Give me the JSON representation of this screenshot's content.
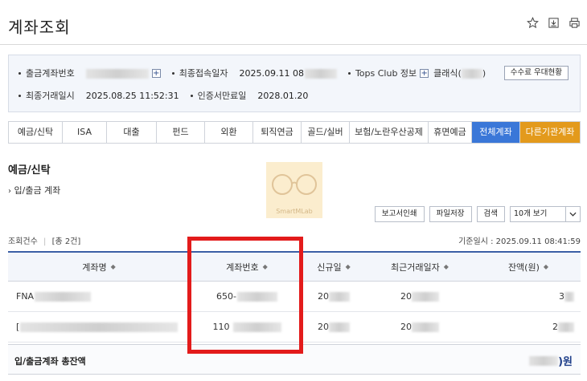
{
  "page": {
    "title": "계좌조회"
  },
  "toolbar": {
    "icons": [
      "star-icon",
      "export-icon",
      "print-icon"
    ]
  },
  "info": {
    "account_no_label": "출금계좌번호",
    "last_login_label": "최종접속일자",
    "last_login_value": "2025.09.11 08",
    "tops_label": "Tops Club 정보",
    "tops_value": "클래식(",
    "tops_value_suffix": ")",
    "last_tx_label": "최종거래일시",
    "last_tx_value": "2025.08.25 11:52:31",
    "cert_label": "인증서만료일",
    "cert_value": "2028.01.20",
    "fee_button": "수수료 우대현황"
  },
  "tabs": [
    {
      "label": "예금/신탁"
    },
    {
      "label": "ISA"
    },
    {
      "label": "대출"
    },
    {
      "label": "펀드"
    },
    {
      "label": "외환"
    },
    {
      "label": "퇴직연금"
    },
    {
      "label": "골드/실버"
    },
    {
      "label": "보험/노란우산공제"
    },
    {
      "label": "휴면예금"
    },
    {
      "label": "전체계좌"
    },
    {
      "label": "다른기관계좌"
    }
  ],
  "section": {
    "title": "예금/신탁",
    "subtitle": "입/출금 계좌"
  },
  "watermark": {
    "text": "SmartMLab"
  },
  "actions": {
    "report_print": "보고서인쇄",
    "save_file": "파일저장",
    "search": "검색",
    "page_size": "10개 보기"
  },
  "meta": {
    "count_label": "조회건수",
    "count_value": "[총 2건]",
    "ref_time_label": "기준일시 :",
    "ref_time_value": "2025.09.11 08:41:59"
  },
  "table": {
    "headers": [
      "계좌명",
      "계좌번호",
      "신규일",
      "최근거래일자",
      "잔액(원)"
    ],
    "rows": [
      {
        "name": "FNA",
        "account": "650-",
        "opened": "20",
        "last_tx": "20",
        "balance": "3"
      },
      {
        "name": "[",
        "account": "110",
        "opened": "20",
        "last_tx": "20",
        "balance": "2"
      }
    ]
  },
  "total": {
    "label": "입/출금계좌 총잔액",
    "value_suffix": ")원"
  },
  "colors": {
    "accent": "#3a77d8",
    "other_tab": "#e39a1c",
    "highlight": "#e31b1b",
    "header_line": "#3b5fa6"
  }
}
